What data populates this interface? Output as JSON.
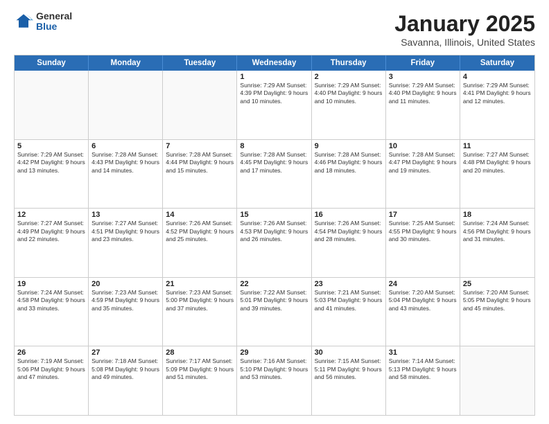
{
  "logo": {
    "general": "General",
    "blue": "Blue"
  },
  "title": {
    "month": "January 2025",
    "location": "Savanna, Illinois, United States"
  },
  "weekdays": [
    "Sunday",
    "Monday",
    "Tuesday",
    "Wednesday",
    "Thursday",
    "Friday",
    "Saturday"
  ],
  "rows": [
    [
      {
        "day": "",
        "info": ""
      },
      {
        "day": "",
        "info": ""
      },
      {
        "day": "",
        "info": ""
      },
      {
        "day": "1",
        "info": "Sunrise: 7:29 AM\nSunset: 4:39 PM\nDaylight: 9 hours\nand 10 minutes."
      },
      {
        "day": "2",
        "info": "Sunrise: 7:29 AM\nSunset: 4:40 PM\nDaylight: 9 hours\nand 10 minutes."
      },
      {
        "day": "3",
        "info": "Sunrise: 7:29 AM\nSunset: 4:40 PM\nDaylight: 9 hours\nand 11 minutes."
      },
      {
        "day": "4",
        "info": "Sunrise: 7:29 AM\nSunset: 4:41 PM\nDaylight: 9 hours\nand 12 minutes."
      }
    ],
    [
      {
        "day": "5",
        "info": "Sunrise: 7:29 AM\nSunset: 4:42 PM\nDaylight: 9 hours\nand 13 minutes."
      },
      {
        "day": "6",
        "info": "Sunrise: 7:28 AM\nSunset: 4:43 PM\nDaylight: 9 hours\nand 14 minutes."
      },
      {
        "day": "7",
        "info": "Sunrise: 7:28 AM\nSunset: 4:44 PM\nDaylight: 9 hours\nand 15 minutes."
      },
      {
        "day": "8",
        "info": "Sunrise: 7:28 AM\nSunset: 4:45 PM\nDaylight: 9 hours\nand 17 minutes."
      },
      {
        "day": "9",
        "info": "Sunrise: 7:28 AM\nSunset: 4:46 PM\nDaylight: 9 hours\nand 18 minutes."
      },
      {
        "day": "10",
        "info": "Sunrise: 7:28 AM\nSunset: 4:47 PM\nDaylight: 9 hours\nand 19 minutes."
      },
      {
        "day": "11",
        "info": "Sunrise: 7:27 AM\nSunset: 4:48 PM\nDaylight: 9 hours\nand 20 minutes."
      }
    ],
    [
      {
        "day": "12",
        "info": "Sunrise: 7:27 AM\nSunset: 4:49 PM\nDaylight: 9 hours\nand 22 minutes."
      },
      {
        "day": "13",
        "info": "Sunrise: 7:27 AM\nSunset: 4:51 PM\nDaylight: 9 hours\nand 23 minutes."
      },
      {
        "day": "14",
        "info": "Sunrise: 7:26 AM\nSunset: 4:52 PM\nDaylight: 9 hours\nand 25 minutes."
      },
      {
        "day": "15",
        "info": "Sunrise: 7:26 AM\nSunset: 4:53 PM\nDaylight: 9 hours\nand 26 minutes."
      },
      {
        "day": "16",
        "info": "Sunrise: 7:26 AM\nSunset: 4:54 PM\nDaylight: 9 hours\nand 28 minutes."
      },
      {
        "day": "17",
        "info": "Sunrise: 7:25 AM\nSunset: 4:55 PM\nDaylight: 9 hours\nand 30 minutes."
      },
      {
        "day": "18",
        "info": "Sunrise: 7:24 AM\nSunset: 4:56 PM\nDaylight: 9 hours\nand 31 minutes."
      }
    ],
    [
      {
        "day": "19",
        "info": "Sunrise: 7:24 AM\nSunset: 4:58 PM\nDaylight: 9 hours\nand 33 minutes."
      },
      {
        "day": "20",
        "info": "Sunrise: 7:23 AM\nSunset: 4:59 PM\nDaylight: 9 hours\nand 35 minutes."
      },
      {
        "day": "21",
        "info": "Sunrise: 7:23 AM\nSunset: 5:00 PM\nDaylight: 9 hours\nand 37 minutes."
      },
      {
        "day": "22",
        "info": "Sunrise: 7:22 AM\nSunset: 5:01 PM\nDaylight: 9 hours\nand 39 minutes."
      },
      {
        "day": "23",
        "info": "Sunrise: 7:21 AM\nSunset: 5:03 PM\nDaylight: 9 hours\nand 41 minutes."
      },
      {
        "day": "24",
        "info": "Sunrise: 7:20 AM\nSunset: 5:04 PM\nDaylight: 9 hours\nand 43 minutes."
      },
      {
        "day": "25",
        "info": "Sunrise: 7:20 AM\nSunset: 5:05 PM\nDaylight: 9 hours\nand 45 minutes."
      }
    ],
    [
      {
        "day": "26",
        "info": "Sunrise: 7:19 AM\nSunset: 5:06 PM\nDaylight: 9 hours\nand 47 minutes."
      },
      {
        "day": "27",
        "info": "Sunrise: 7:18 AM\nSunset: 5:08 PM\nDaylight: 9 hours\nand 49 minutes."
      },
      {
        "day": "28",
        "info": "Sunrise: 7:17 AM\nSunset: 5:09 PM\nDaylight: 9 hours\nand 51 minutes."
      },
      {
        "day": "29",
        "info": "Sunrise: 7:16 AM\nSunset: 5:10 PM\nDaylight: 9 hours\nand 53 minutes."
      },
      {
        "day": "30",
        "info": "Sunrise: 7:15 AM\nSunset: 5:11 PM\nDaylight: 9 hours\nand 56 minutes."
      },
      {
        "day": "31",
        "info": "Sunrise: 7:14 AM\nSunset: 5:13 PM\nDaylight: 9 hours\nand 58 minutes."
      },
      {
        "day": "",
        "info": ""
      }
    ]
  ]
}
